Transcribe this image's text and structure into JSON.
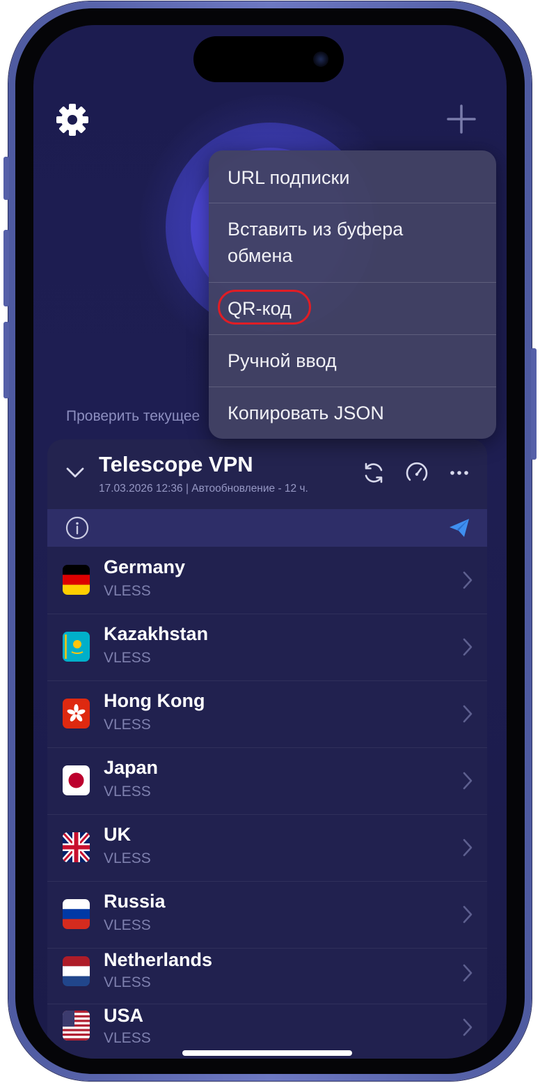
{
  "menu": {
    "items": [
      {
        "label": "URL подписки"
      },
      {
        "label": "Вставить из буфера обмена"
      },
      {
        "label": "QR-код",
        "highlighted": true
      },
      {
        "label": "Ручной ввод"
      },
      {
        "label": "Копировать JSON"
      }
    ],
    "highlight_color": "#e01d25"
  },
  "check_ip_text": "Проверить текущее",
  "subscription": {
    "title": "Telescope VPN",
    "meta": "17.03.2026 12:36 | Автообновление - 12 ч."
  },
  "servers": [
    {
      "name": "Germany",
      "protocol": "VLESS",
      "flag": "de"
    },
    {
      "name": "Kazakhstan",
      "protocol": "VLESS",
      "flag": "kz"
    },
    {
      "name": "Hong Kong",
      "protocol": "VLESS",
      "flag": "hk"
    },
    {
      "name": "Japan",
      "protocol": "VLESS",
      "flag": "jp"
    },
    {
      "name": "UK",
      "protocol": "VLESS",
      "flag": "gb"
    },
    {
      "name": "Russia",
      "protocol": "VLESS",
      "flag": "ru"
    },
    {
      "name": "Netherlands",
      "protocol": "VLESS",
      "flag": "nl"
    },
    {
      "name": "USA",
      "protocol": "VLESS",
      "flag": "us"
    }
  ],
  "icons": {
    "settings": "gear-icon",
    "add": "plus-icon",
    "collapse": "chevron-down-icon",
    "refresh": "refresh-icon",
    "speed_test": "speedometer-icon",
    "more": "more-icon",
    "info": "info-icon",
    "telegram": "send-icon",
    "row_arrow": "chevron-right-icon"
  },
  "colors": {
    "background": "#1c1c50",
    "accent": "#5a53e8",
    "menu_bg": "#424264",
    "telegram": "#3f8ff0"
  }
}
